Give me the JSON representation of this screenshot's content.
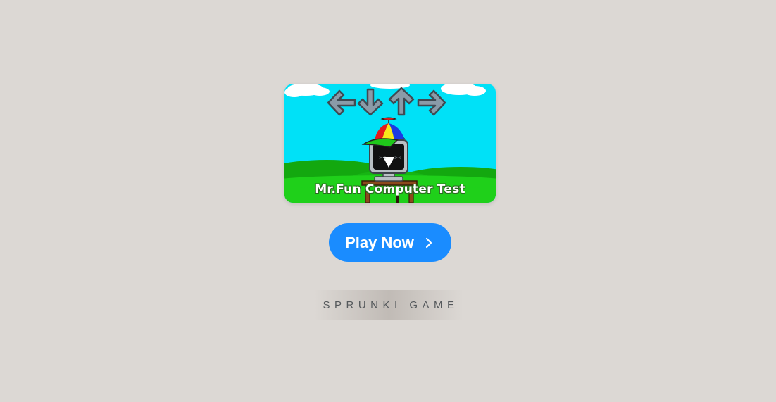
{
  "game": {
    "thumbnail_title": "Mr.Fun Computer Test",
    "play_button_label": "Play Now",
    "brand_text": "SPRUNKI GAME"
  },
  "colors": {
    "page_background": "#dcd8d4",
    "play_button": "#1a8cff",
    "sky": "#00e1f7",
    "grass": "#1fd01a"
  }
}
